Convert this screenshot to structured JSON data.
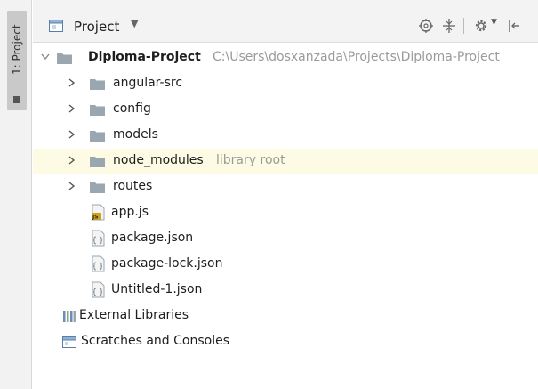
{
  "side_panel": {
    "tab_label": "1: Project"
  },
  "toolbar": {
    "title": "Project",
    "dropdown_glyph": "▼"
  },
  "tree": {
    "root": {
      "name": "Diploma-Project",
      "path": "C:\\Users\\dosxanzada\\Projects\\Diploma-Project",
      "expanded": true
    },
    "items": [
      {
        "name": "angular-src",
        "type": "folder",
        "expanded": false
      },
      {
        "name": "config",
        "type": "folder",
        "expanded": false
      },
      {
        "name": "models",
        "type": "folder",
        "expanded": false
      },
      {
        "name": "node_modules",
        "type": "folder",
        "hint": "library root",
        "expanded": false,
        "highlighted": true
      },
      {
        "name": "routes",
        "type": "folder",
        "expanded": false
      },
      {
        "name": "app.js",
        "type": "js-file"
      },
      {
        "name": "package.json",
        "type": "json-file"
      },
      {
        "name": "package-lock.json",
        "type": "json-file"
      },
      {
        "name": "Untitled-1.json",
        "type": "json-file"
      }
    ],
    "external_libraries": "External Libraries",
    "scratches": "Scratches and Consoles"
  },
  "colors": {
    "folder": "#9aa7b0",
    "highlight_row": "#fdfbe3",
    "hint_text": "#9a9a9a",
    "js_badge": "#c9a227"
  }
}
